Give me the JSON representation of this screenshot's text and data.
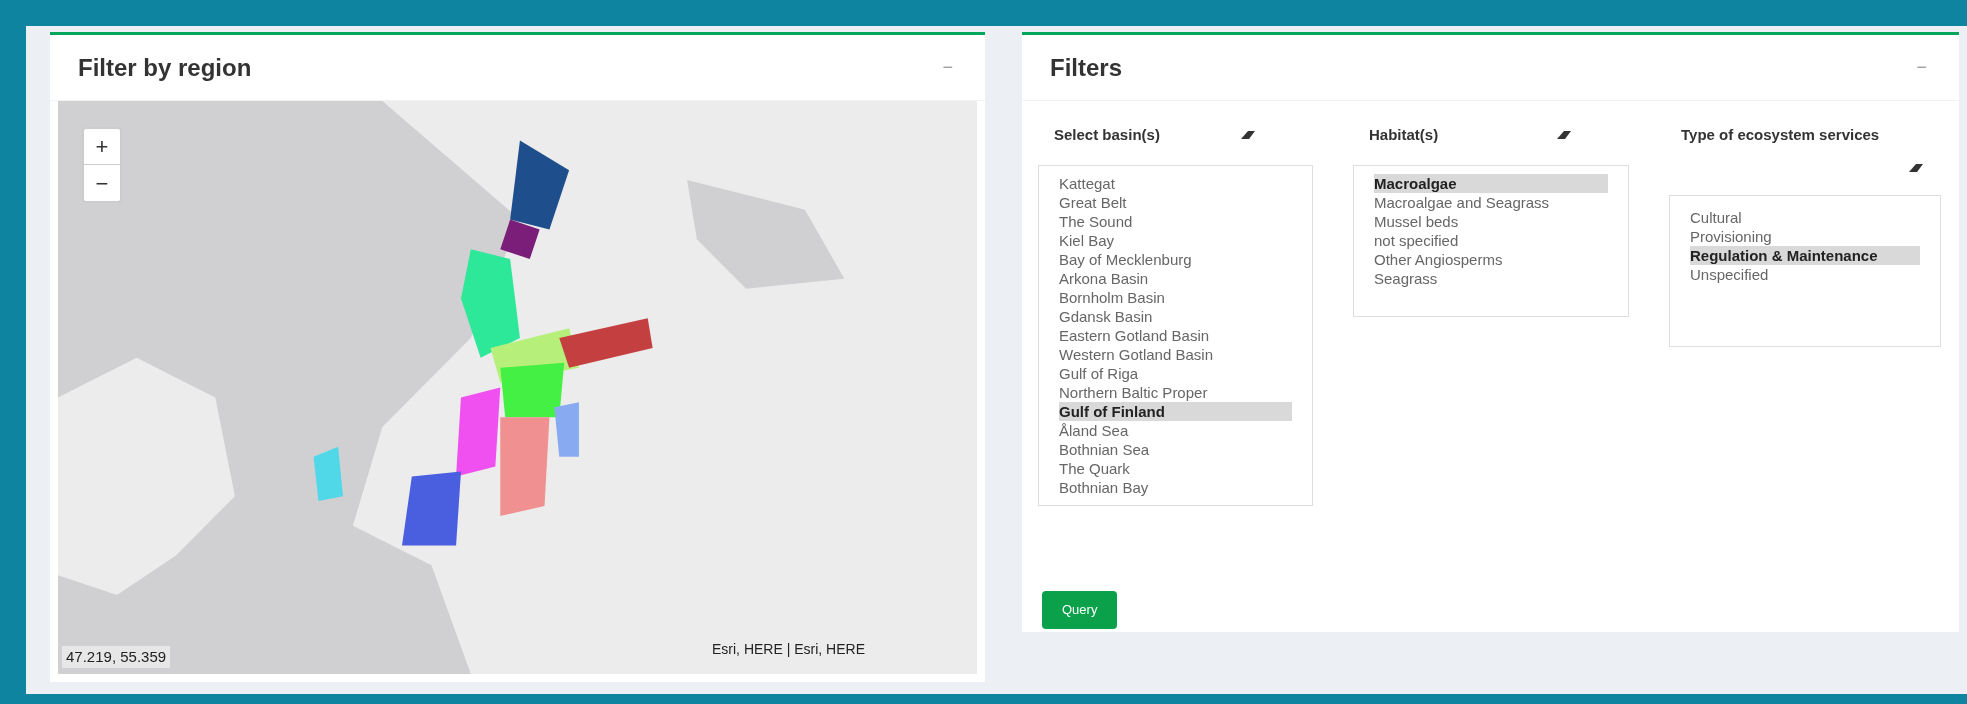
{
  "region_panel": {
    "title": "Filter by region",
    "collapse": "−",
    "map": {
      "zoom_in": "+",
      "zoom_out": "−",
      "coordinates": "47.219, 55.359",
      "attribution": "Esri, HERE | Esri, HERE"
    }
  },
  "filters_panel": {
    "title": "Filters",
    "collapse": "−",
    "columns": [
      {
        "label": "Select basin(s)",
        "options": [
          {
            "text": "Kattegat",
            "selected": false
          },
          {
            "text": "Great Belt",
            "selected": false
          },
          {
            "text": "The Sound",
            "selected": false
          },
          {
            "text": "Kiel Bay",
            "selected": false
          },
          {
            "text": "Bay of Mecklenburg",
            "selected": false
          },
          {
            "text": "Arkona Basin",
            "selected": false
          },
          {
            "text": "Bornholm Basin",
            "selected": false
          },
          {
            "text": "Gdansk Basin",
            "selected": false
          },
          {
            "text": "Eastern Gotland Basin",
            "selected": false
          },
          {
            "text": "Western Gotland Basin",
            "selected": false
          },
          {
            "text": "Gulf of Riga",
            "selected": false
          },
          {
            "text": "Northern Baltic Proper",
            "selected": false
          },
          {
            "text": "Gulf of Finland",
            "selected": true
          },
          {
            "text": "Åland Sea",
            "selected": false
          },
          {
            "text": "Bothnian Sea",
            "selected": false
          },
          {
            "text": "The Quark",
            "selected": false
          },
          {
            "text": "Bothnian Bay",
            "selected": false
          }
        ]
      },
      {
        "label": "Habitat(s)",
        "options": [
          {
            "text": "Macroalgae",
            "selected": true
          },
          {
            "text": "Macroalgae and Seagrass",
            "selected": false
          },
          {
            "text": "Mussel beds",
            "selected": false
          },
          {
            "text": "not specified",
            "selected": false
          },
          {
            "text": "Other Angiosperms",
            "selected": false
          },
          {
            "text": "Seagrass",
            "selected": false
          }
        ]
      },
      {
        "label": "Type of ecosystem services",
        "options": [
          {
            "text": "Cultural",
            "selected": false
          },
          {
            "text": "Provisioning",
            "selected": false
          },
          {
            "text": "Regulation & Maintenance",
            "selected": true
          },
          {
            "text": "Unspecified",
            "selected": false
          }
        ]
      }
    ],
    "query_button": "Query"
  }
}
